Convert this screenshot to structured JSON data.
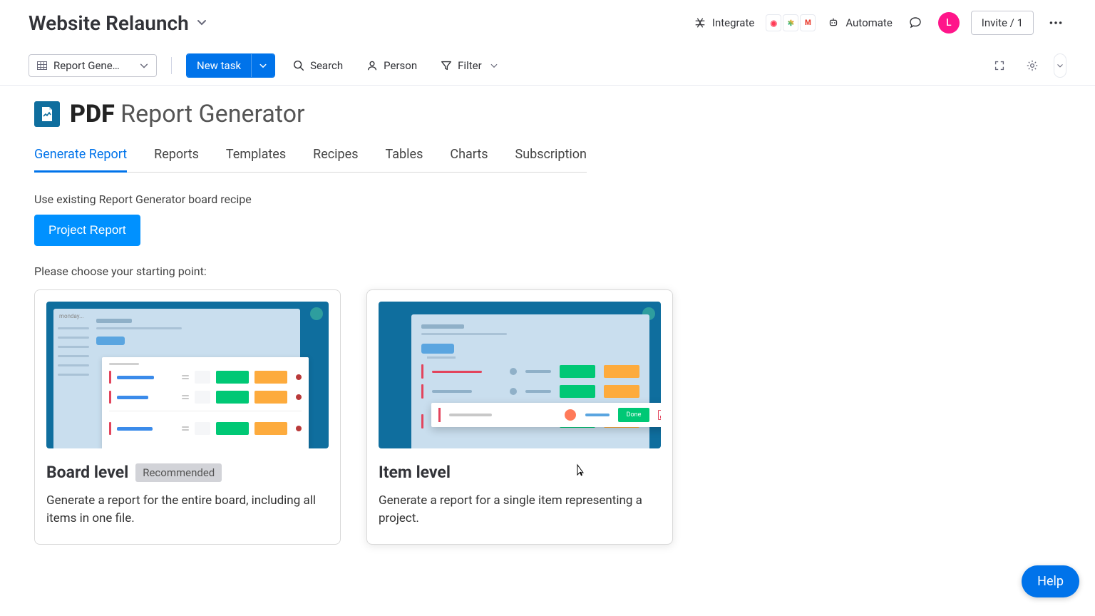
{
  "header": {
    "board_title": "Website Relaunch",
    "integrate_label": "Integrate",
    "automate_label": "Automate",
    "invite_label": "Invite / 1",
    "avatar_initial": "L",
    "integration_icons": [
      "monday",
      "slack",
      "gmail"
    ]
  },
  "toolbar": {
    "view_label": "Report Gene…",
    "new_task_label": "New task",
    "search_label": "Search",
    "person_label": "Person",
    "filter_label": "Filter"
  },
  "app": {
    "title_bold": "PDF",
    "title_rest": "Report Generator"
  },
  "tabs": [
    {
      "label": "Generate Report",
      "active": true
    },
    {
      "label": "Reports",
      "active": false
    },
    {
      "label": "Templates",
      "active": false
    },
    {
      "label": "Recipes",
      "active": false
    },
    {
      "label": "Tables",
      "active": false
    },
    {
      "label": "Charts",
      "active": false
    },
    {
      "label": "Subscription",
      "active": false
    }
  ],
  "content": {
    "recipe_prompt": "Use existing Report Generator board recipe",
    "recipe_button": "Project Report",
    "choose_prompt": "Please choose your starting point:"
  },
  "cards": {
    "board": {
      "title": "Board level",
      "badge": "Recommended",
      "desc": "Generate a report for the entire board, including all items in one file."
    },
    "item": {
      "title": "Item level",
      "desc": "Generate a report for a single item representing a project.",
      "popup_done": "Done"
    }
  },
  "help_label": "Help"
}
